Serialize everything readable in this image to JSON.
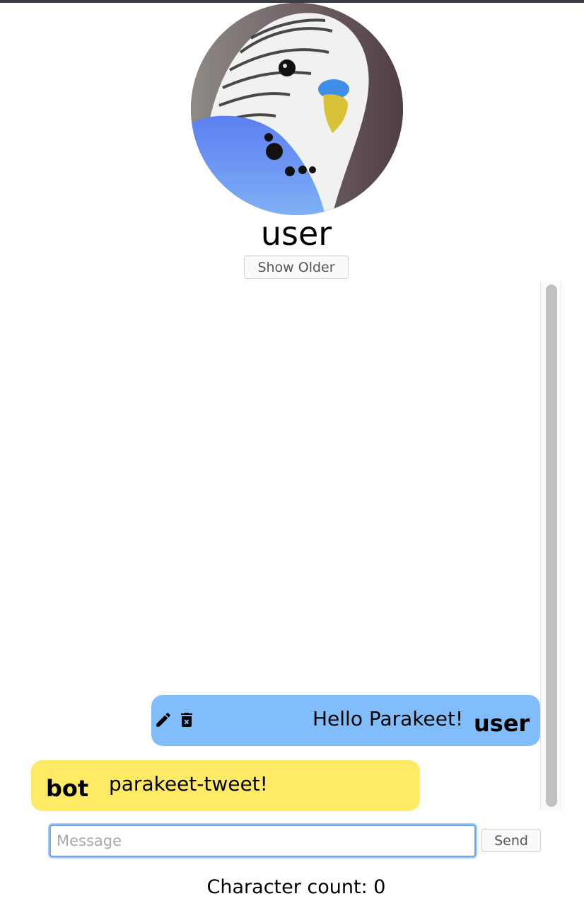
{
  "profile": {
    "avatar_icon": "parakeet-photo",
    "username": "user"
  },
  "history": {
    "show_older_label": "Show Older"
  },
  "messages": [
    {
      "sender": "user",
      "text": "Hello Parakeet!",
      "color": "#82bdfb",
      "actions": [
        "edit-icon",
        "delete-icon"
      ]
    },
    {
      "sender": "bot",
      "text": "parakeet-tweet!",
      "color": "#feea64"
    }
  ],
  "composer": {
    "placeholder": "Message",
    "value": "",
    "send_label": "Send",
    "char_count_label": "Character count:",
    "char_count": "0"
  }
}
